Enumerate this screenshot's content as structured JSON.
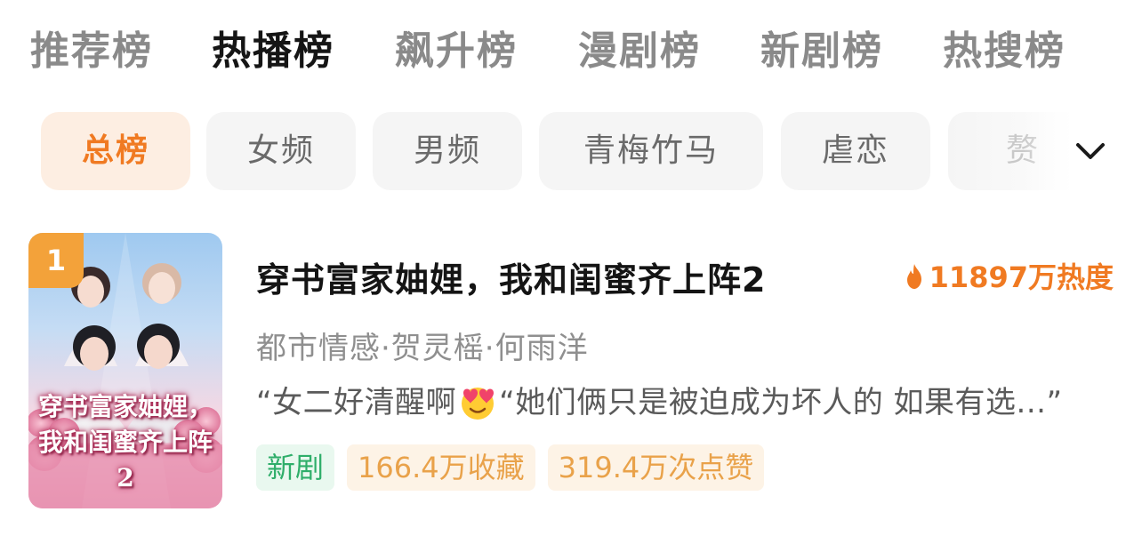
{
  "top_tabs": [
    {
      "label": "推荐榜",
      "active": false
    },
    {
      "label": "热播榜",
      "active": true
    },
    {
      "label": "飙升榜",
      "active": false
    },
    {
      "label": "漫剧榜",
      "active": false
    },
    {
      "label": "新剧榜",
      "active": false
    },
    {
      "label": "热搜榜",
      "active": false
    }
  ],
  "chips": [
    {
      "label": "总榜",
      "active": true
    },
    {
      "label": "女频",
      "active": false
    },
    {
      "label": "男频",
      "active": false
    },
    {
      "label": "青梅竹马",
      "active": false
    },
    {
      "label": "虐恋",
      "active": false
    },
    {
      "label": "赘",
      "active": false
    }
  ],
  "expand_icon": "chevron-down-icon",
  "colors": {
    "accent": "#f07a22",
    "active_text": "#151515",
    "inactive_text": "#8a8a8a",
    "active_chip_bg": "#fdeee2",
    "chip_bg": "#f5f5f5",
    "tag_green": "#2fae6a",
    "tag_orange": "#e9a24a",
    "rank_badge": "#f3a23a"
  },
  "items": [
    {
      "rank": "1",
      "title": "穿书富家妯娌，我和闺蜜齐上阵2",
      "heat": "11897万热度",
      "heat_icon": "flame-icon",
      "meta": "都市情感·贺灵榣·何雨洋",
      "comment_before": "“女二好清醒啊",
      "comment_emoji": "heart-eyes-emoji",
      "comment_after": "“她们俩只是被迫成为坏人的 如果有选...”",
      "cover_title_line1": "穿书富家妯娌，",
      "cover_title_line2": "我和闺蜜齐上阵2",
      "tags": [
        {
          "label": "新剧",
          "style": "green"
        },
        {
          "label": "166.4万收藏",
          "style": "orange"
        },
        {
          "label": "319.4万次点赞",
          "style": "orange"
        }
      ]
    }
  ]
}
